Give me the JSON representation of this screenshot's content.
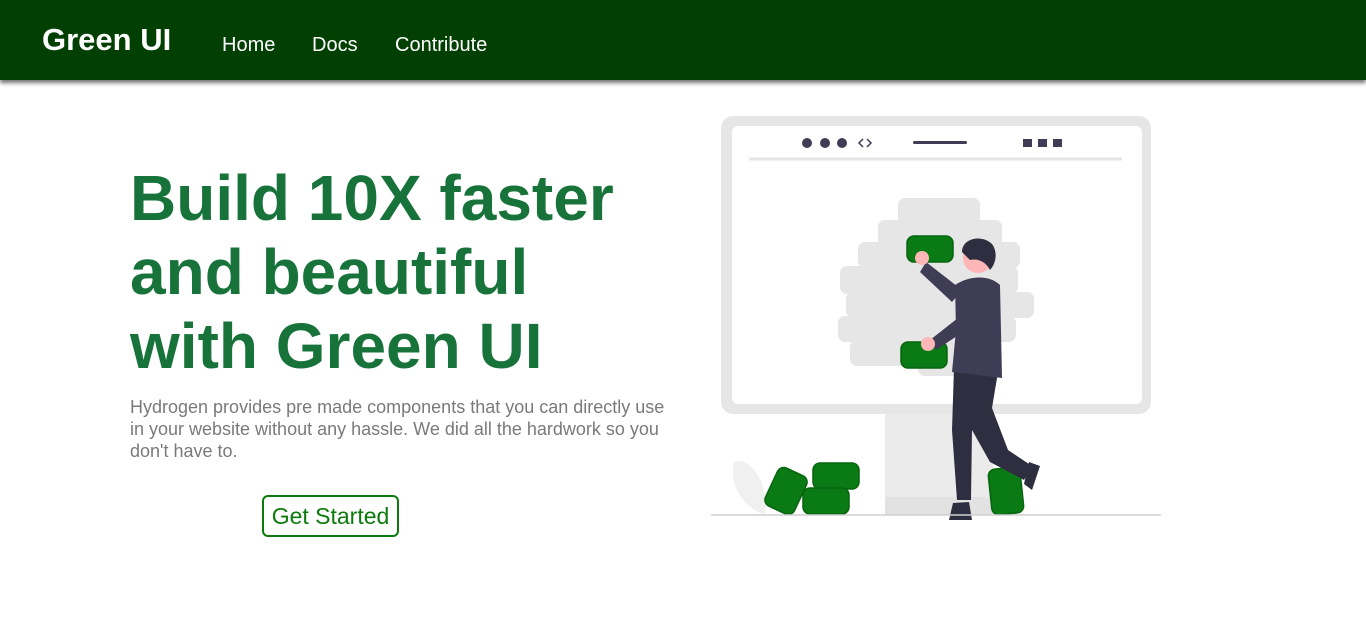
{
  "navbar": {
    "brand": "Green UI",
    "links": [
      "Home",
      "Docs",
      "Contribute"
    ]
  },
  "hero": {
    "headline_lines": [
      "Build 10X faster",
      "and beautiful",
      "with Green UI"
    ],
    "subtitle": "Hydrogen provides pre made components that you can directly use in your website without any hassle. We did all the hardwork so you don't have to.",
    "cta_label": "Get Started"
  },
  "colors": {
    "navbar_bg": "#023f02",
    "headline": "#17733a",
    "accent": "#0b7b0b",
    "subtitle": "#7a7a7a",
    "illustration_figure": "#3f3d56",
    "illustration_block": "#007b0e"
  },
  "illustration": {
    "icon": "developer-building-webpage-illustration"
  }
}
